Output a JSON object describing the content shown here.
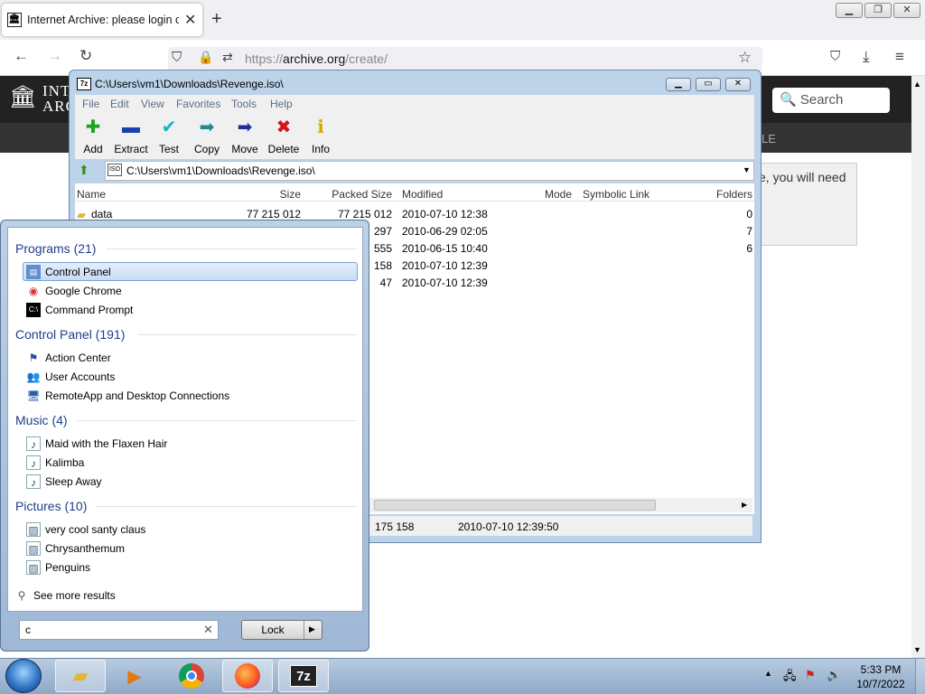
{
  "browser": {
    "tab_title": "Internet Archive: please login or",
    "url_domain": "archive.org",
    "url_prefix": "https://",
    "url_path": "/create/"
  },
  "archive_page": {
    "logo_line1": "INT",
    "logo_line2": "ARC",
    "search_placeholder": "Search",
    "nav_fragment": "LE",
    "notice_line1": "e, you will need"
  },
  "sevenzip": {
    "title": "C:\\Users\\vm1\\Downloads\\Revenge.iso\\",
    "menu": [
      "File",
      "Edit",
      "View",
      "Favorites",
      "Tools",
      "Help"
    ],
    "toolbar": [
      "Add",
      "Extract",
      "Test",
      "Copy",
      "Move",
      "Delete",
      "Info"
    ],
    "address": "C:\\Users\\vm1\\Downloads\\Revenge.iso\\",
    "columns": [
      "Name",
      "Size",
      "Packed Size",
      "Modified",
      "Mode",
      "Symbolic Link",
      "Folders"
    ],
    "rows": [
      {
        "name": "data",
        "size": "77 215 012",
        "packed": "77 215 012",
        "modified": "2010-07-10 12:38",
        "folders": "0"
      },
      {
        "packed": "297",
        "modified": "2010-06-29 02:05",
        "folders": "7"
      },
      {
        "packed": "555",
        "modified": "2010-06-15 10:40",
        "folders": "6"
      },
      {
        "packed": "158",
        "modified": "2010-07-10 12:39"
      },
      {
        "packed": "47",
        "modified": "2010-07-10 12:39"
      }
    ],
    "status_size": "175 158",
    "status_date": "2010-07-10 12:39:50"
  },
  "start_menu": {
    "groups": [
      {
        "title": "Programs (21)",
        "items": [
          "Control Panel",
          "Google Chrome",
          "Command Prompt"
        ]
      },
      {
        "title": "Control Panel (191)",
        "items": [
          "Action Center",
          "User Accounts",
          "RemoteApp and Desktop Connections"
        ]
      },
      {
        "title": "Music (4)",
        "items": [
          "Maid with the Flaxen Hair",
          "Kalimba",
          "Sleep Away"
        ]
      },
      {
        "title": "Pictures (10)",
        "items": [
          "very cool santy claus",
          "Chrysanthemum",
          "Penguins"
        ]
      }
    ],
    "see_more": "See more results",
    "search_value": "c",
    "lock_label": "Lock"
  },
  "taskbar": {
    "time": "5:33 PM",
    "date": "10/7/2022"
  }
}
